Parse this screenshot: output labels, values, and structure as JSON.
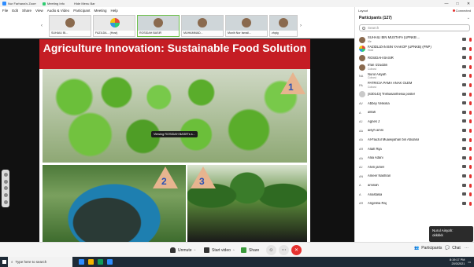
{
  "window": {
    "title": "Nur Farhana's Zoom",
    "meeting_info": "Meeting Info",
    "hide_menu": "Hide Menu Bar",
    "controls": [
      "—",
      "□",
      "✕"
    ]
  },
  "menu": [
    "File",
    "Edit",
    "Share",
    "View",
    "Audio & Video",
    "Participant",
    "Meeting",
    "Help"
  ],
  "thumbnails": [
    {
      "label": "SUHAILI BI..."
    },
    {
      "label": "FAZILDA... (Host)"
    },
    {
      "label": "ROSIDAH BASIR"
    },
    {
      "label": "MUHAMMAD..."
    },
    {
      "label": "Munih Nor Ismail..."
    },
    {
      "label": "zhpig"
    }
  ],
  "view_tag": "Viewing ROSIDAH BASIR's s...",
  "layout_label": "Layout",
  "slide": {
    "title": "Agriculture Innovation: Sustainable Food Solution",
    "markers": [
      "1",
      "2",
      "3"
    ]
  },
  "panel": {
    "connection": "Connected",
    "header": "Participants (127)",
    "search_placeholder": "Search",
    "participants": [
      {
        "name": "SUHAILI BIN MUSTAFA (UPNKB ...",
        "role": "Me",
        "initials": "",
        "avatar": "photo"
      },
      {
        "name": "FAZIDLIZAN BIN YAAKOP (UPNKB) (PNP)",
        "role": "Host",
        "initials": "",
        "avatar": "logo"
      },
      {
        "name": "ROSIDAH BASIR",
        "role": "",
        "initials": "",
        "avatar": "photo"
      },
      {
        "name": "Irfan Izzuddin",
        "role": "Cohost",
        "initials": "",
        "avatar": "photo"
      },
      {
        "name": "Nurul Aisyah",
        "role": "Cohost",
        "initials": "NA",
        "avatar": ""
      },
      {
        "name": "PATRICIA PAMA ANAK OLEM",
        "role": "Cohost",
        "initials": "PA",
        "avatar": ""
      },
      {
        "name": "[S30143] Trishasanthesia poster",
        "role": "",
        "initials": "",
        "avatar": "grey"
      },
      {
        "name": "Abbey Velexka",
        "role": "",
        "initials": "AV",
        "avatar": ""
      },
      {
        "name": "afifah",
        "role": "",
        "initials": "A",
        "avatar": ""
      },
      {
        "name": "Agnes J",
        "role": "",
        "initials": "AJ",
        "avatar": ""
      },
      {
        "name": "aisyh amni",
        "role": "",
        "initials": "AA",
        "avatar": ""
      },
      {
        "name": "Al-Fauzul Muawiyahan bin Abulana",
        "role": "",
        "initials": "AA",
        "avatar": ""
      },
      {
        "name": "Aliah Rija",
        "role": "",
        "initials": "AR",
        "avatar": ""
      },
      {
        "name": "Aliia Adani",
        "role": "",
        "initials": "AA",
        "avatar": ""
      },
      {
        "name": "Alvin james",
        "role": "",
        "initials": "AJ",
        "avatar": ""
      },
      {
        "name": "Ameer Nashran",
        "role": "",
        "initials": "AN",
        "avatar": ""
      },
      {
        "name": "aminah",
        "role": "",
        "initials": "A",
        "avatar": ""
      },
      {
        "name": "Anastasia",
        "role": "",
        "initials": "A",
        "avatar": ""
      },
      {
        "name": "Angelina Raj",
        "role": "",
        "initials": "AR",
        "avatar": ""
      }
    ]
  },
  "toast": {
    "name": "Nurul Aisyah:",
    "message": "okkkkk"
  },
  "controlbar": {
    "unmute": "Unmute",
    "start_video": "Start video",
    "share": "Share",
    "participants": "Participants",
    "participants_count": "127",
    "chat": "Chat"
  },
  "taskbar": {
    "search_placeholder": "Type here to search",
    "time": "8:19:17 PM",
    "date": "20/3/2021"
  },
  "colors": {
    "slide_title_bg": "#c51d24",
    "leave": "#e5312f",
    "taskbar": "#1e2a36"
  }
}
